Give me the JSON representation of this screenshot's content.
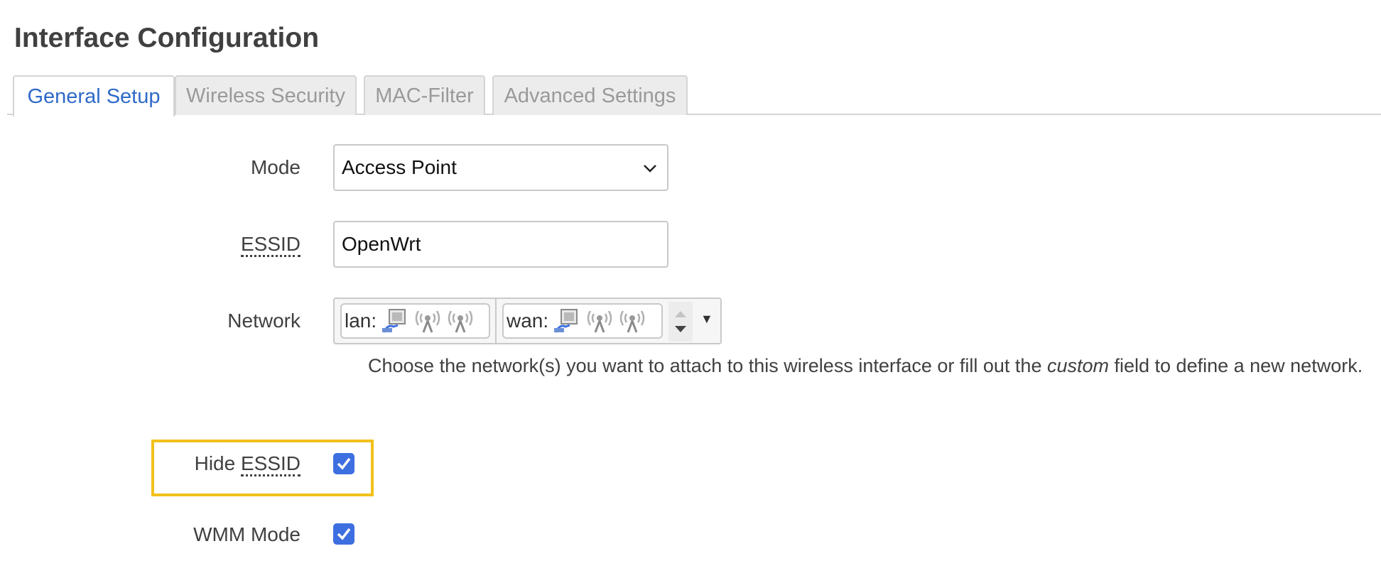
{
  "page": {
    "title": "Interface Configuration"
  },
  "tabs": [
    {
      "label": "General Setup",
      "active": true
    },
    {
      "label": "Wireless Security",
      "active": false
    },
    {
      "label": "MAC-Filter",
      "active": false
    },
    {
      "label": "Advanced Settings",
      "active": false
    }
  ],
  "form": {
    "mode": {
      "label": "Mode",
      "value": "Access Point"
    },
    "essid": {
      "label": "ESSID",
      "value": "OpenWrt"
    },
    "network": {
      "label": "Network",
      "chips": [
        {
          "label": "lan:",
          "icons": [
            "ethernet-port-icon",
            "wifi-disabled-icon",
            "wifi-disabled-icon"
          ]
        },
        {
          "label": "wan:",
          "icons": [
            "ethernet-port-icon",
            "wifi-disabled-icon",
            "wifi-disabled-icon"
          ]
        }
      ],
      "help_before": "Choose the network(s) you want to attach to this wireless interface or fill out the ",
      "help_em": "custom",
      "help_after": " field to define a new network."
    },
    "hide_essid": {
      "label_prefix": "Hide ",
      "label_abbr": "ESSID",
      "checked": true
    },
    "wmm_mode": {
      "label": "WMM Mode",
      "checked": true
    }
  },
  "colors": {
    "accent": "#3d6fe0",
    "active_tab": "#2f6ac9",
    "highlight": "#f2c11a"
  }
}
